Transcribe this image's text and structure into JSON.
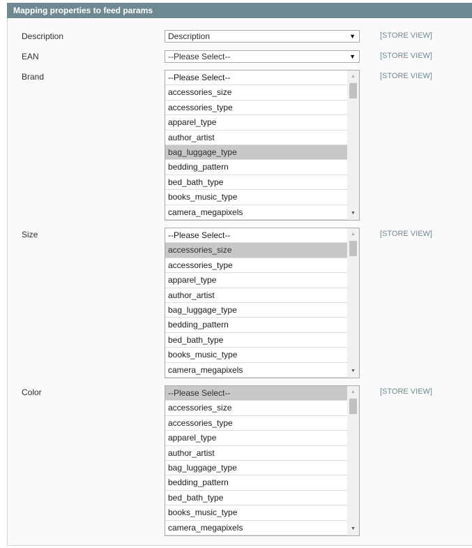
{
  "panel": {
    "title": "Mapping properties to feed params"
  },
  "fields": [
    {
      "label": "Description",
      "type": "select",
      "value": "Description",
      "scope": "[STORE VIEW]"
    },
    {
      "label": "EAN",
      "type": "select",
      "value": "--Please Select--",
      "scope": "[STORE VIEW]"
    },
    {
      "label": "Brand",
      "type": "multiselect",
      "selected": "bag_luggage_type",
      "scope": "[STORE VIEW]"
    },
    {
      "label": "Size",
      "type": "multiselect",
      "selected": "accessories_size",
      "scope": "[STORE VIEW]"
    },
    {
      "label": "Color",
      "type": "multiselect",
      "selected": "--Please Select--",
      "scope": "[STORE VIEW]"
    }
  ],
  "options": [
    "--Please Select--",
    "accessories_size",
    "accessories_type",
    "apparel_type",
    "author_artist",
    "bag_luggage_type",
    "bedding_pattern",
    "bed_bath_type",
    "books_music_type",
    "camera_megapixels"
  ],
  "icons": {
    "select_arrow": "▼",
    "scroll_up": "▲",
    "scroll_down": "▼"
  }
}
